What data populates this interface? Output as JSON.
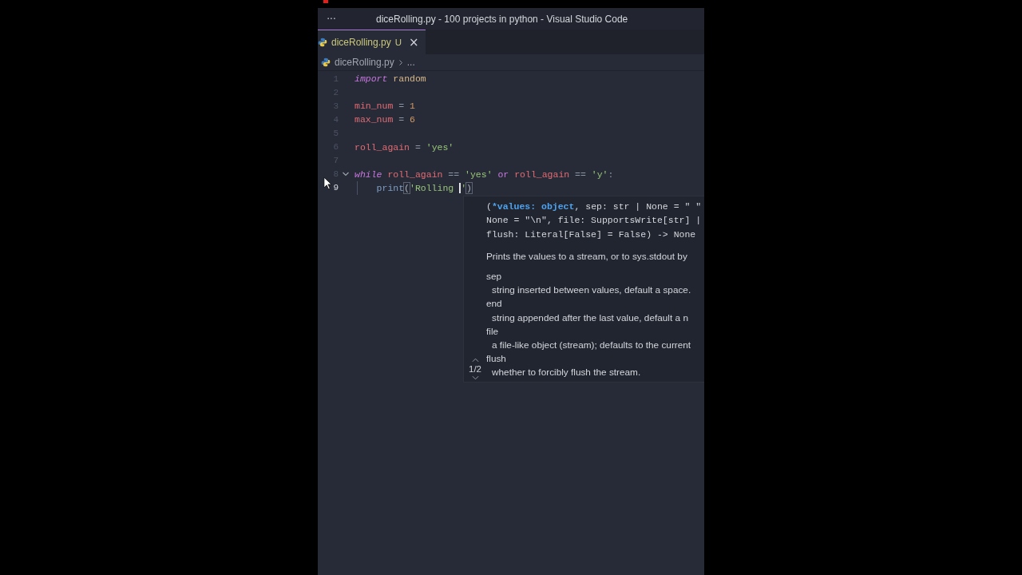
{
  "window": {
    "title": "diceRolling.py - 100 projects in python - Visual Studio Code",
    "menu": "···"
  },
  "tabs": [
    {
      "label": "diceRolling.py",
      "badge": "U",
      "close": "×",
      "selected": true
    }
  ],
  "breadcrumb": {
    "file": "diceRolling.py",
    "more": "..."
  },
  "editor": {
    "lines": [
      {
        "number": "1",
        "active": false,
        "tokens": [
          {
            "kind": "keyword",
            "text": "import"
          },
          {
            "kind": "module",
            "text": " random"
          }
        ]
      },
      {
        "number": "2",
        "active": false
      },
      {
        "number": "3",
        "active": false,
        "tokens": [
          {
            "kind": "variable",
            "text": "min_num"
          },
          {
            "kind": "op",
            "text": " = "
          },
          {
            "kind": "number",
            "text": "1"
          }
        ]
      },
      {
        "number": "4",
        "active": false,
        "tokens": [
          {
            "kind": "variable",
            "text": "max_num"
          },
          {
            "kind": "op",
            "text": " = "
          },
          {
            "kind": "number",
            "text": "6"
          }
        ]
      },
      {
        "number": "5",
        "active": false
      },
      {
        "number": "6",
        "active": false,
        "tokens": [
          {
            "kind": "variable",
            "text": "roll_again"
          },
          {
            "kind": "op",
            "text": " = "
          },
          {
            "kind": "string",
            "text": "'yes'"
          }
        ]
      },
      {
        "number": "7",
        "active": false
      },
      {
        "number": "8",
        "active": false,
        "fold": true,
        "tokens": [
          {
            "kind": "keyword",
            "text": "while"
          },
          {
            "kind": "variable",
            "text": " roll_again"
          },
          {
            "kind": "op",
            "text": " == "
          },
          {
            "kind": "string",
            "text": "'yes'"
          },
          {
            "kind": "keyword2",
            "text": " or "
          },
          {
            "kind": "variable",
            "text": "roll_again"
          },
          {
            "kind": "op",
            "text": " == "
          },
          {
            "kind": "string",
            "text": "'y'"
          },
          {
            "kind": "op",
            "text": ":"
          }
        ]
      },
      {
        "number": "9",
        "active": true,
        "indent": true,
        "tokens": [
          {
            "kind": "func",
            "text": "print"
          },
          {
            "kind": "bracket",
            "text": "("
          },
          {
            "kind": "string",
            "text": "'Rolling "
          },
          {
            "kind": "cursor"
          },
          {
            "kind": "string",
            "text": "'"
          },
          {
            "kind": "bracket",
            "text": ")"
          }
        ]
      }
    ]
  },
  "hover": {
    "signature": [
      [
        {
          "kind": "plain",
          "text": "("
        },
        {
          "kind": "active",
          "text": "*values: object"
        },
        {
          "kind": "plain",
          "text": ", sep: str | None = \" \""
        }
      ],
      [
        {
          "kind": "plain",
          "text": "None = \"\\n\", file: SupportsWrite[str] |"
        }
      ],
      [
        {
          "kind": "plain",
          "text": "flush: Literal[False] = False) -> None"
        }
      ]
    ],
    "description": "Prints the values to a stream, or to sys.stdout by",
    "params": [
      {
        "name": "sep",
        "text": "string inserted between values, default a space."
      },
      {
        "name": "end",
        "text": "string appended after the last value, default a n"
      },
      {
        "name": "file",
        "text": "a file-like object (stream); defaults to the current"
      },
      {
        "name": "flush",
        "text": "whether to forcibly flush the stream."
      }
    ],
    "pager": "1/2"
  }
}
